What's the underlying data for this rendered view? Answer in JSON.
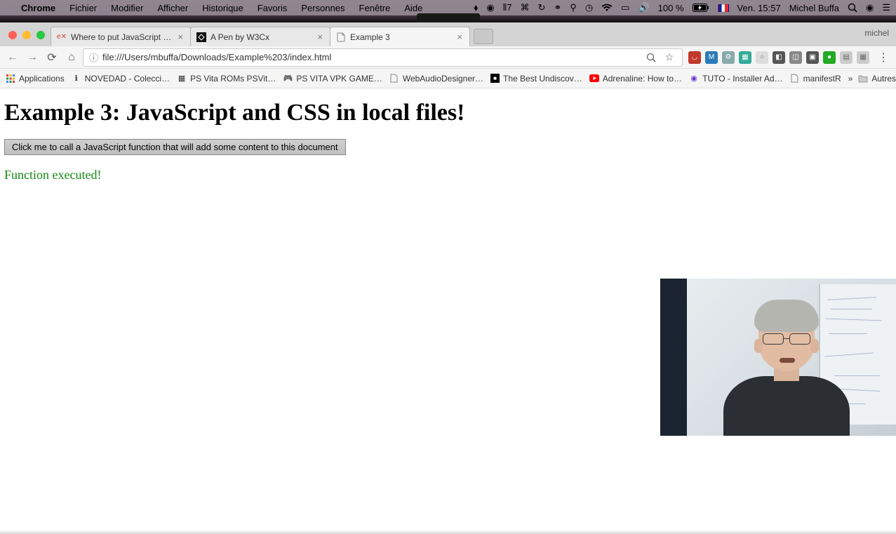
{
  "menubar": {
    "app": "Chrome",
    "items": [
      "Fichier",
      "Modifier",
      "Afficher",
      "Historique",
      "Favoris",
      "Personnes",
      "Fenêtre",
      "Aide"
    ],
    "battery": "100 %",
    "clock": "Ven. 15:57",
    "user": "Michel Buffa"
  },
  "tabs": [
    {
      "label": "Where to put JavaScript code",
      "active": false
    },
    {
      "label": "A Pen by W3Cx",
      "active": false
    },
    {
      "label": "Example 3",
      "active": true
    }
  ],
  "profile": "michel",
  "url": "file:///Users/mbuffa/Downloads/Example%203/index.html",
  "bookmarks": [
    "Applications",
    "NOVEDAD - Colecci…",
    "PS Vita ROMs PSVit…",
    "PS VITA VPK GAME…",
    "WebAudioDesigner…",
    "The Best Undiscov…",
    "Adrenaline: How to…",
    "TUTO - Installer Ad…",
    "manifestR"
  ],
  "bookmarks_overflow": "»",
  "bookmarks_other": "Autres favoris",
  "page": {
    "heading": "Example 3: JavaScript and CSS in local files!",
    "button": "Click me to call a JavaScript function that will add some content to this document",
    "result": "Function executed!"
  }
}
